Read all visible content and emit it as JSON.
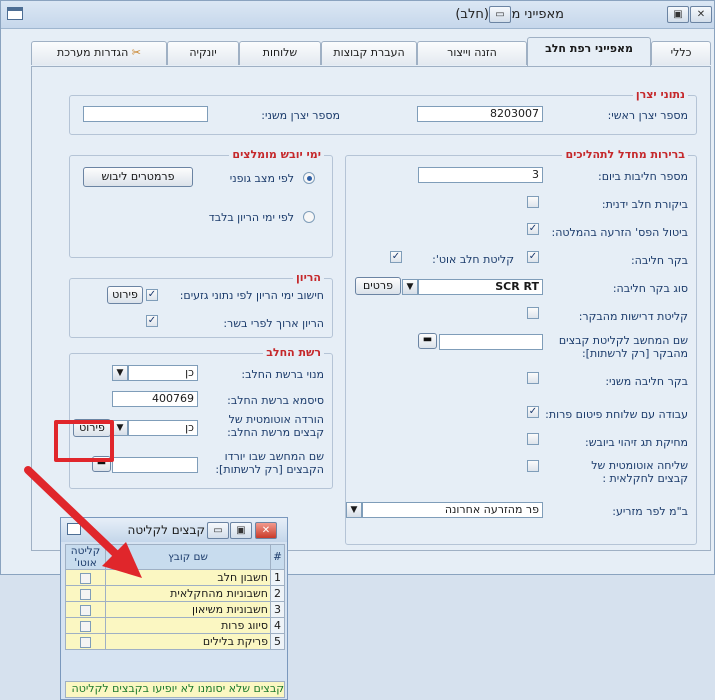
{
  "window": {
    "title": "מאפייני משק (חלב)",
    "minimize": "▭",
    "maximize": "▣",
    "close": "✕"
  },
  "tabs": [
    {
      "label": "כללי"
    },
    {
      "label": "מאפייני רפת חלב"
    },
    {
      "label": "הזנה וייצור"
    },
    {
      "label": "העברת קבוצות"
    },
    {
      "label": "שלוחות"
    },
    {
      "label": "יונקיה"
    },
    {
      "label": "הגדרות מערכת"
    }
  ],
  "producer": {
    "title": "נתוני יצרן",
    "main_label": "מספר יצרן ראשי:",
    "main_value": "8203007",
    "second_label": "מספר יצרן משני:",
    "second_value": ""
  },
  "defaults": {
    "title": "ברירות מחדל לתהליכים",
    "milkings_label": "מספר חליבות ביום:",
    "milkings_value": "3",
    "manual_check_label": "ביקורת חלב ידנית:",
    "cancel_stop_label": "ביטול הפס' הזרעה בהמלטה:",
    "milking_ctrl_label": "בקר חליבה:",
    "auto_milk_label": "קליטת חלב אוט':",
    "ctrl_type_label": "סוג בקר חליבה:",
    "ctrl_type_value": "SCR RT",
    "details_btn": "פרטים",
    "req_label": "קליטת דרישות מהבקר:",
    "computer_label": "שם המחשב לקליטת קבצים מהבקר [רק לרשתות]:",
    "second_ctrl_label": "בקר חליבה משני:",
    "work_label": "עבודה עם שלוחת פיטום פרות:",
    "tag_label": "מחיקת תג זיהוי ביובש:",
    "auto_send_label": "שליחה אוטומטית של קבצים לחקלאית :",
    "mzrie_label": "ב\"מ לפר מזריע:",
    "mzrie_value": "פר מהזרעה אחרונה"
  },
  "dry": {
    "title": "ימי יובש מומלצים",
    "params_btn": "פרמטרים ליבוש",
    "by_body": "לפי מצב גופני",
    "by_preg": "לפי ימי הריון בלבד"
  },
  "pregnancy": {
    "title": "הריון",
    "calc_label": "חישוב ימי הריון לפי נתוני גזעים:",
    "detail_btn": "פירוט",
    "long_label": "הריון ארוך לפרי בשר:"
  },
  "network": {
    "title": "רשת החלב",
    "member_label": "מנוי ברשת החלב:",
    "member_value": "כן",
    "password_label": "סיסמא ברשת החלב:",
    "password_value": "400769",
    "auto_dl_label": "הורדה אוטומטית של קבצים מרשת החלב:",
    "auto_dl_value": "כן",
    "detail_btn": "פירוט",
    "computer_label": "שם המחשב שבו יורדו הקבצים [רק לרשתות]:"
  },
  "popup": {
    "title": "קבצים לקליטה",
    "col_num": "#",
    "col_name": "שם קובץ",
    "col_auto": "קליטה אוטו'",
    "rows": [
      {
        "num": "1",
        "name": "חשבון חלב"
      },
      {
        "num": "2",
        "name": "חשבוניות מהחקלאית"
      },
      {
        "num": "3",
        "name": "חשבוניות משיאון"
      },
      {
        "num": "4",
        "name": "סיווג פרות"
      },
      {
        "num": "5",
        "name": "פריקת בלילים"
      }
    ],
    "footer": "קבצים שלא יסומנו לא יופיעו בקבצים לקליטה"
  },
  "colors": {
    "accent_red": "#e0262b",
    "section_title": "#c5282b",
    "label_blue": "#1b3b6b"
  }
}
